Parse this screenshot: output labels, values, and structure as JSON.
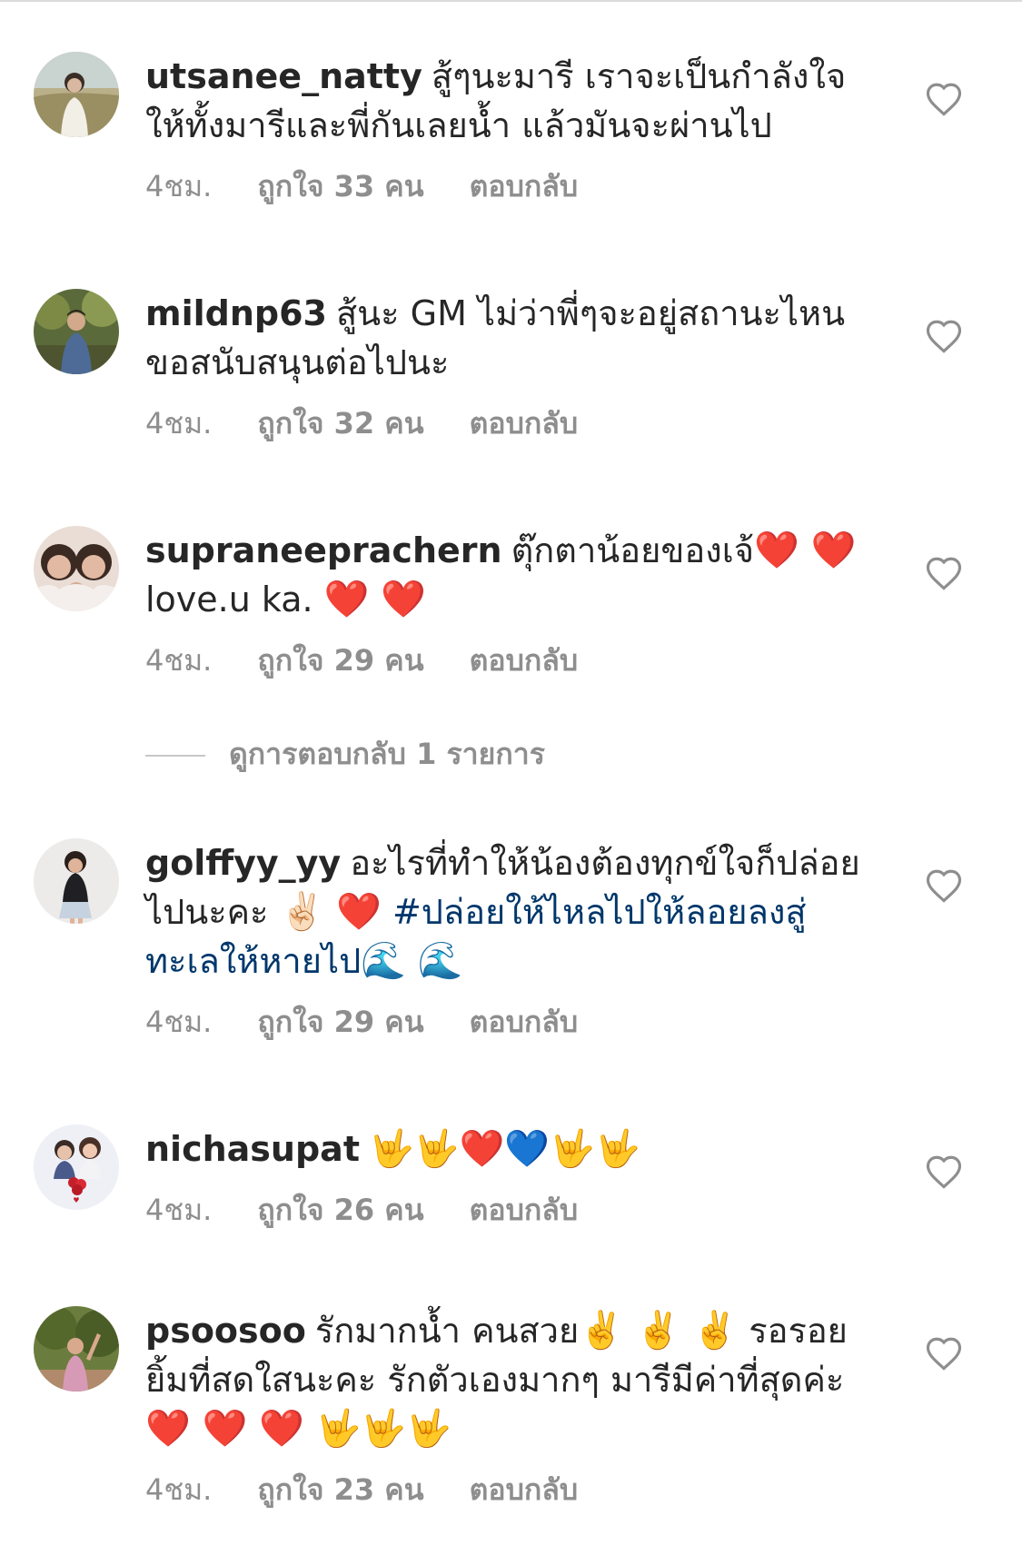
{
  "colors": {
    "username": "#262626",
    "meta": "#8e8e8e",
    "hashtag": "#00376b",
    "heart_outline": "#8e8e8e"
  },
  "comments": [
    {
      "username": "utsanee_natty",
      "text": "สู้ๆนะมารี เราจะเป็นกำลังใจให้ทั้งมารีและพี่กันเลยน้ำ แล้วมันจะผ่านไป",
      "time": "4ชม.",
      "likes": "ถูกใจ 33 คน",
      "reply": "ตอบกลับ",
      "avatar_icon": "avatar-photo-icon"
    },
    {
      "username": "mildnp63",
      "text": "สู้นะ GM ไม่ว่าพี่ๆจะอยู่สถานะไหน ขอสนับสนุนต่อไปนะ",
      "time": "4ชม.",
      "likes": "ถูกใจ 32 คน",
      "reply": "ตอบกลับ",
      "avatar_icon": "avatar-photo-icon"
    },
    {
      "username": "supraneeprachern",
      "text": "ตุ๊กตาน้อยของเจ้",
      "emoji1": "❤️ ❤️",
      "text2": "love.u ka.",
      "emoji2": "❤️ ❤️",
      "time": "4ชม.",
      "likes": "ถูกใจ 29 คน",
      "reply": "ตอบกลับ",
      "avatar_icon": "avatar-photo-icon"
    },
    {
      "username": "golffyy_yy",
      "text": "อะไรที่ทำให้น้องต้องทุกข์ใจก็ปล่อยไปนะคะ",
      "emoji1": "✌🏻 ❤️",
      "hashtag": "#ปล่อยให้ไหลไปให้ลอยลงสู่ทะเลให้หายไป",
      "emoji2": "🌊 🌊",
      "time": "4ชม.",
      "likes": "ถูกใจ 29 คน",
      "reply": "ตอบกลับ",
      "avatar_icon": "avatar-photo-icon"
    },
    {
      "username": "nichasupat",
      "emoji1": "🤟🤟❤️💙🤟🤟",
      "time": "4ชม.",
      "likes": "ถูกใจ 26 คน",
      "reply": "ตอบกลับ",
      "avatar_icon": "avatar-photo-icon"
    },
    {
      "username": "psoosoo",
      "text": "รักมากน้ำ คนสวย",
      "emoji1": "✌️ ✌️ ✌️",
      "text2": "รอรอยยิ้มที่สดใสนะคะ รักตัวเองมากๆ มารีมีค่าที่สุดค่ะ",
      "emoji2": "❤️ ❤️ ❤️ 🤟🤟🤟",
      "time": "4ชม.",
      "likes": "ถูกใจ 23 คน",
      "reply": "ตอบกลับ",
      "avatar_icon": "avatar-photo-icon"
    }
  ],
  "view_replies": "ดูการตอบกลับ 1 รายการ",
  "heart_icon": "heart-outline-icon"
}
